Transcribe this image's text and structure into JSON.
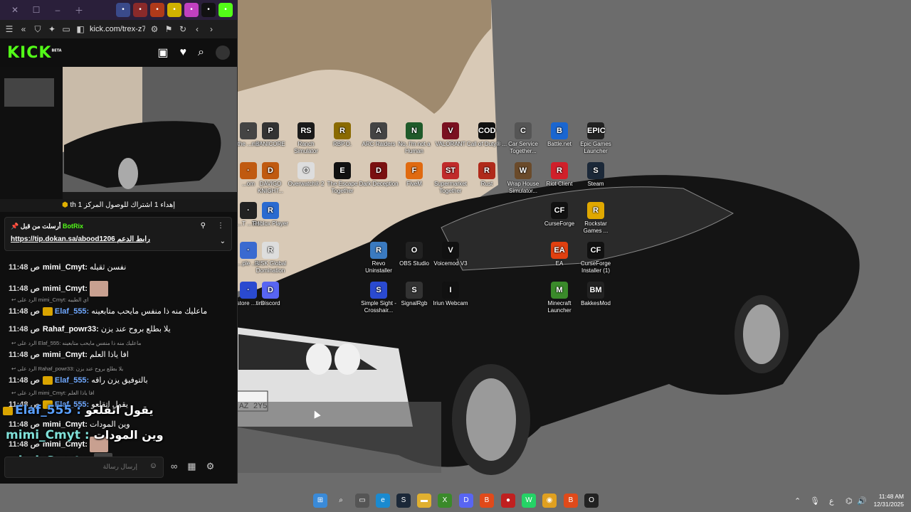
{
  "desktop_icons": [
    {
      "id": "pancore",
      "label": "PANICORE",
      "color": "#333333",
      "glyph": "P"
    },
    {
      "id": "ranch",
      "label": "Ranch Simulator",
      "color": "#1b1b1b",
      "glyph": "RS"
    },
    {
      "id": "rbpo",
      "label": "RBP.O.",
      "color": "#8a6a00",
      "glyph": "R"
    },
    {
      "id": "arc",
      "label": "ARC Raiders",
      "color": "#444444",
      "glyph": "A"
    },
    {
      "id": "nomanshuman",
      "label": "No, I'm not a Human",
      "color": "#1f5a2a",
      "glyph": "N"
    },
    {
      "id": "valorant",
      "label": "VALORANT",
      "color": "#7a1020",
      "glyph": "V"
    },
    {
      "id": "cod",
      "label": "Call of Duty® ...",
      "color": "#111111",
      "glyph": "COD"
    },
    {
      "id": "carservice",
      "label": "Car Service Together...",
      "color": "#555555",
      "glyph": "C"
    },
    {
      "id": "battlenet",
      "label": "Battle.net",
      "color": "#1a66d0",
      "glyph": "B"
    },
    {
      "id": "epic",
      "label": "Epic Games Launcher",
      "color": "#222222",
      "glyph": "EPIC"
    },
    {
      "id": "davigo",
      "label": "DAVIGO KNIGHT...",
      "color": "#c05a10",
      "glyph": "D"
    },
    {
      "id": "overwatch",
      "label": "Overwatch® 2",
      "color": "#dddddd",
      "glyph": "O"
    },
    {
      "id": "escape",
      "label": "The Escape Together",
      "color": "#111111",
      "glyph": "E"
    },
    {
      "id": "darkdeception",
      "label": "Dark Deception",
      "color": "#7a1010",
      "glyph": "D"
    },
    {
      "id": "fivem",
      "label": "FiveM",
      "color": "#e06a10",
      "glyph": "F"
    },
    {
      "id": "supermarket",
      "label": "Supermarket Together",
      "color": "#c02a2a",
      "glyph": "ST"
    },
    {
      "id": "rust",
      "label": "Rust",
      "color": "#b02a1a",
      "glyph": "R"
    },
    {
      "id": "wraphouse",
      "label": "Wrap House Simulator...",
      "color": "#6a4a2a",
      "glyph": "W"
    },
    {
      "id": "riot",
      "label": "Riot Client",
      "color": "#d0202a",
      "glyph": "R"
    },
    {
      "id": "steam",
      "label": "Steam",
      "color": "#1b2838",
      "glyph": "S"
    },
    {
      "id": "roblox",
      "label": "Roblox Player",
      "color": "#2a6ad0",
      "glyph": "R"
    },
    {
      "id": "curseforge",
      "label": "CurseForge",
      "color": "#111111",
      "glyph": "CF"
    },
    {
      "id": "rockstar",
      "label": "Rockstar Games ...",
      "color": "#e0a800",
      "glyph": "R"
    },
    {
      "id": "risk",
      "label": "RISK Global Domination",
      "color": "#dddddd",
      "glyph": "R"
    },
    {
      "id": "revo",
      "label": "Revo Uninstaller",
      "color": "#3a7ac0",
      "glyph": "R"
    },
    {
      "id": "obs",
      "label": "OBS Studio",
      "color": "#222222",
      "glyph": "O"
    },
    {
      "id": "voicemod",
      "label": "Voicemod V3",
      "color": "#111111",
      "glyph": "V"
    },
    {
      "id": "ea",
      "label": "EA",
      "color": "#e04010",
      "glyph": "EA"
    },
    {
      "id": "cfinstaller",
      "label": "CurseForge Installer (1)",
      "color": "#111111",
      "glyph": "CF"
    },
    {
      "id": "simplesight",
      "label": "Simple Sight - Crosshair...",
      "color": "#2a4ad0",
      "glyph": "S"
    },
    {
      "id": "signalrgb",
      "label": "SignalRgb",
      "color": "#333333",
      "glyph": "S"
    },
    {
      "id": "iriun",
      "label": "Iriun Webcam",
      "color": "#111111",
      "glyph": "I"
    },
    {
      "id": "minecraft",
      "label": "Minecraft Launcher",
      "color": "#3a8a2a",
      "glyph": "M"
    },
    {
      "id": "bakkes",
      "label": "BakkesMod",
      "color": "#222222",
      "glyph": "BM"
    },
    {
      "id": "discord",
      "label": "Discord",
      "color": "#5865f2",
      "glyph": "D"
    },
    {
      "id": "cut1",
      "label": "the ...ms",
      "color": "#444444",
      "glyph": "·"
    },
    {
      "id": "cut2",
      "label": "...om",
      "color": "#c05a10",
      "glyph": "·"
    },
    {
      "id": "cut3",
      "label": "...T ...TH",
      "color": "#222222",
      "glyph": "·"
    },
    {
      "id": "cut4",
      "label": "...ple ...s",
      "color": "#3a6ad0",
      "glyph": "·"
    },
    {
      "id": "cut5",
      "label": "...store ...tins",
      "color": "#2a4ad0",
      "glyph": "·"
    }
  ],
  "browser": {
    "url": "kick.com/trex-z7",
    "tab_icons": [
      "#3a4a8a",
      "#8a2a2a",
      "#b03a1a",
      "#d0b000",
      "#c040c0",
      "#111111",
      "#53fc18"
    ]
  },
  "kick": {
    "logo": "KICK",
    "logo_tag": "BETA",
    "goal_text": "th إهداء 1 اشتراك للوصول المركز 1",
    "pinned": {
      "by": "أرسلت من قبل",
      "bot": "BotRix",
      "link_label": "رابط الدعم",
      "link": "https://tip.dokan.sa/abood1206"
    },
    "chat_placeholder": "إرسال رسالة"
  },
  "chat": [
    {
      "time": "11:48 ص",
      "user": "mimi_Cmyt",
      "color": "#ffffff",
      "text": "نفسن ثقيله",
      "reply": ""
    },
    {
      "time": "11:48 ص",
      "user": "mimi_Cmyt",
      "color": "#ffffff",
      "text": "",
      "reply": ""
    },
    {
      "time": "11:48 ص",
      "user": "Elaf_555",
      "color": "#6fa8ff",
      "text": "ماعليك منه ذا منفس مايحب متابعينه",
      "reply": "الرد على mimi_Cmyt: اي الطيبه"
    },
    {
      "time": "11:48 ص",
      "user": "Rahaf_powr33",
      "color": "#ffffff",
      "text": "يلا بطلع بروح عند يزن",
      "reply": ""
    },
    {
      "time": "11:48 ص",
      "user": "mimi_Cmyt",
      "color": "#ffffff",
      "text": "افا ياذا العلم",
      "reply": "الرد على Elaf_555: ماعليك منه ذا منفس مايحب متابعينه"
    },
    {
      "time": "11:48 ص",
      "user": "Elaf_555",
      "color": "#6fa8ff",
      "text": "بالتوفيق يزن راقه",
      "reply": "الرد على Rahaf_powr33: يلا بطلع بروح عند يزن"
    },
    {
      "time": "11:48 ص",
      "user": "Elaf_555",
      "color": "#6fa8ff",
      "text": "يقول اتقلعو",
      "reply": "الرد على mimi_Cmyt: افا ياذا العلم"
    },
    {
      "time": "11:48 ص",
      "user": "mimi_Cmyt",
      "color": "#ffffff",
      "text": "وين المودات",
      "reply": ""
    },
    {
      "time": "11:48 ص",
      "user": "mimi_Cmyt",
      "color": "#ffffff",
      "text": "",
      "reply": ""
    }
  ],
  "overlay": [
    {
      "user": "Elaf_555",
      "color": "#5aa0ff",
      "text": "يقول اتقلعو"
    },
    {
      "user": "mimi_Cmyt",
      "color": "#7fe0d8",
      "text": "وين المودات"
    },
    {
      "user": "mimi_Cmyt",
      "color": "#7fe0d8",
      "text": ""
    }
  ],
  "taskbar": {
    "apps": [
      {
        "name": "windows-start",
        "color": "#3a8ad8",
        "glyph": "⊞"
      },
      {
        "name": "search",
        "color": "transparent",
        "glyph": "⌕"
      },
      {
        "name": "file-explorer-task",
        "color": "#555555",
        "glyph": "▭"
      },
      {
        "name": "edge",
        "color": "#1a8ad0",
        "glyph": "e"
      },
      {
        "name": "steam",
        "color": "#1b2838",
        "glyph": "S"
      },
      {
        "name": "folder",
        "color": "#e0b030",
        "glyph": "▬"
      },
      {
        "name": "xbox",
        "color": "#3a8a2a",
        "glyph": "X"
      },
      {
        "name": "discord",
        "color": "#5865f2",
        "glyph": "D"
      },
      {
        "name": "brave",
        "color": "#e04a1a",
        "glyph": "B"
      },
      {
        "name": "rec",
        "color": "#c02020",
        "glyph": "●"
      },
      {
        "name": "whatsapp",
        "color": "#25d366",
        "glyph": "W"
      },
      {
        "name": "chrome",
        "color": "#e0a020",
        "glyph": "◉"
      },
      {
        "name": "brave2",
        "color": "#e04a1a",
        "glyph": "B"
      },
      {
        "name": "obs",
        "color": "#222222",
        "glyph": "O"
      }
    ],
    "lang": "ع",
    "time": "11:48 AM",
    "date": "12/31/2025"
  }
}
